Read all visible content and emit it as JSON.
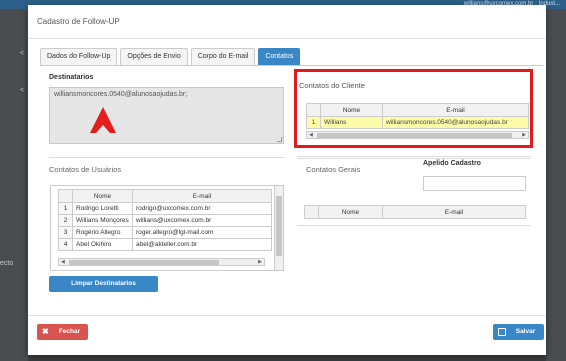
{
  "background": {
    "user_text": "willians@uxcomex.com.br · Indust...",
    "side_glyphs": [
      "<",
      "<",
      "ecto"
    ]
  },
  "modal": {
    "title": "Cadastro de Follow-UP"
  },
  "tabs": [
    {
      "label": "Dados do Follow-Up",
      "active": false
    },
    {
      "label": "Opções de Envio",
      "active": false
    },
    {
      "label": "Corpo do E-mail",
      "active": false
    },
    {
      "label": "Contatos",
      "active": true
    }
  ],
  "destinatarios": {
    "label": "Destinatarios",
    "value": "williansmoncores.0540@alunosaojudas.br;"
  },
  "contatos_cliente": {
    "label": "Contatos do Cliente",
    "headers": [
      "",
      "Nome",
      "E-mail"
    ],
    "rows": [
      {
        "num": "1",
        "nome": "Willians",
        "email": "williansmoncores.0540@alunosaojudas.br"
      }
    ]
  },
  "contatos_usuarios": {
    "label": "Contatos de Usuários",
    "headers": [
      "",
      "Nome",
      "E-mail"
    ],
    "rows": [
      {
        "num": "1",
        "nome": "Rodrigo Loretti",
        "email": "rodrigo@uxcomex.com.br"
      },
      {
        "num": "2",
        "nome": "Willians Monçores",
        "email": "willians@uxcomex.com.br"
      },
      {
        "num": "3",
        "nome": "Rogério Allegro",
        "email": "roger.allegro@lgl-mail.com"
      },
      {
        "num": "4",
        "nome": "Abel Okihiro",
        "email": "abel@akteller.com.br"
      }
    ]
  },
  "contatos_gerais": {
    "label": "Contatos Gerais",
    "apelido_label": "Apelido Cadastro",
    "apelido_value": "",
    "headers": [
      "",
      "Nome",
      "E-mail"
    ]
  },
  "buttons": {
    "limpar": "Limpar Destinatarios",
    "fechar": "Fechar",
    "salvar": "Salvar"
  },
  "colors": {
    "accent": "#3a87c8",
    "danger": "#d9534f",
    "highlight_box": "#e01b1b",
    "selected_row": "#fdfca8"
  }
}
